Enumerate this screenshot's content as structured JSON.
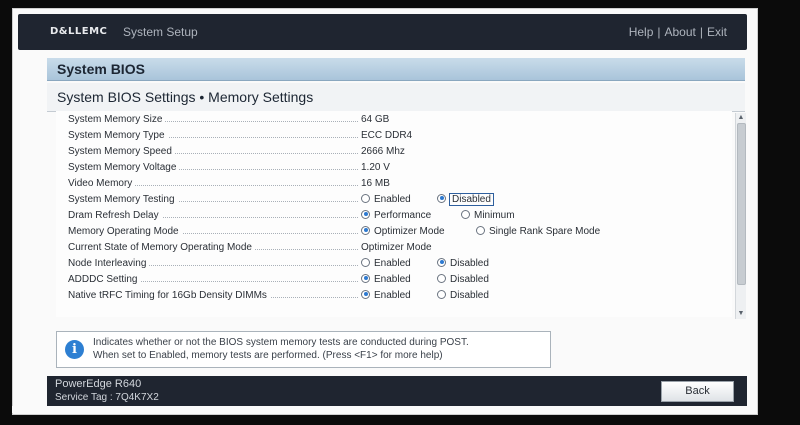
{
  "header": {
    "brand": "D&LLEMC",
    "title": "System Setup",
    "links": [
      "Help",
      "About",
      "Exit"
    ]
  },
  "section": {
    "title": "System BIOS"
  },
  "page": {
    "title": "System BIOS Settings • Memory Settings"
  },
  "settings": [
    {
      "label": "System Memory Size",
      "value": "64 GB"
    },
    {
      "label": "System Memory Type",
      "value": "ECC DDR4"
    },
    {
      "label": "System Memory Speed",
      "value": "2666 Mhz"
    },
    {
      "label": "System Memory Voltage",
      "value": "1.20 V"
    },
    {
      "label": "Video Memory",
      "value": "16 MB"
    },
    {
      "label": "System Memory Testing",
      "options": [
        "Enabled",
        "Disabled"
      ],
      "selected": "Disabled"
    },
    {
      "label": "Dram Refresh Delay",
      "options": [
        "Performance",
        "Minimum"
      ],
      "selected": "Performance"
    },
    {
      "label": "Memory Operating Mode",
      "options": [
        "Optimizer Mode",
        "Single Rank Spare Mode"
      ],
      "selected": "Optimizer Mode"
    },
    {
      "label": "Current State of Memory Operating Mode",
      "value": "Optimizer Mode"
    },
    {
      "label": "Node Interleaving",
      "options": [
        "Enabled",
        "Disabled"
      ],
      "selected": "Disabled"
    },
    {
      "label": "ADDDC Setting",
      "options": [
        "Enabled",
        "Disabled"
      ],
      "selected": "Enabled"
    },
    {
      "label": "Native tRFC Timing for 16Gb Density DIMMs",
      "options": [
        "Enabled",
        "Disabled"
      ],
      "selected": "Enabled"
    }
  ],
  "help": {
    "line1": "Indicates whether or not the BIOS system memory tests are conducted during POST.",
    "line2": "When set to Enabled, memory tests are performed. (Press <F1> for more help)"
  },
  "footer": {
    "model": "PowerEdge R640",
    "service_tag": "Service Tag : 7Q4K7X2",
    "back_label": "Back"
  },
  "colors": {
    "header_bg": "#1f2530",
    "section_bg": "#b7cfe2",
    "radio_selected": "#2e7ad1",
    "info_icon": "#2d7fd2"
  }
}
